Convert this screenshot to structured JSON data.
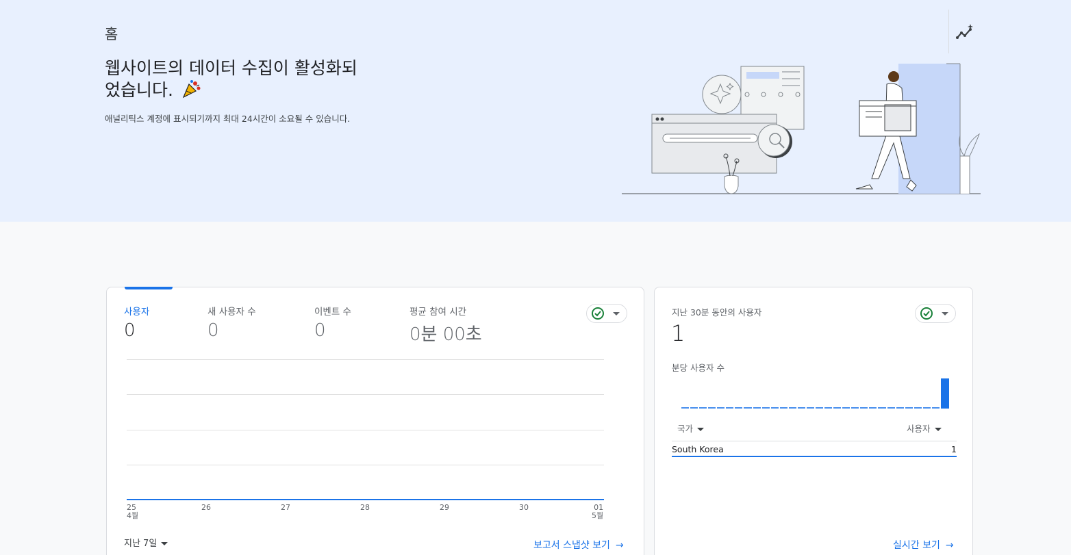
{
  "hero": {
    "title": "홈",
    "headline_line1": "웹사이트의 데이터 수집이 활성화되",
    "headline_line2": "었습니다.",
    "subtext": "애널리틱스 계정에 표시되기까지 최대 24시간이 소요될 수 있습니다."
  },
  "overview_card": {
    "metrics": [
      {
        "label": "사용자",
        "value": "0"
      },
      {
        "label": "새 사용자 수",
        "value": "0"
      },
      {
        "label": "이벤트 수",
        "value": "0"
      },
      {
        "label": "평균 참여 시간",
        "value": "0분 00초"
      }
    ],
    "x_ticks": [
      {
        "day": "25",
        "month": "4월"
      },
      {
        "day": "26",
        "month": ""
      },
      {
        "day": "27",
        "month": ""
      },
      {
        "day": "28",
        "month": ""
      },
      {
        "day": "29",
        "month": ""
      },
      {
        "day": "30",
        "month": ""
      },
      {
        "day": "01",
        "month": "5월"
      }
    ],
    "date_range": "지난 7일",
    "report_link": "보고서 스냅샷 보기"
  },
  "realtime_card": {
    "label": "지난 30분 동안의 사용자",
    "value": "1",
    "per_minute_label": "분당 사용자 수",
    "per_minute_values": [
      0,
      0,
      0,
      0,
      0,
      0,
      0,
      0,
      0,
      0,
      0,
      0,
      0,
      0,
      0,
      0,
      0,
      0,
      0,
      0,
      0,
      0,
      0,
      0,
      0,
      0,
      0,
      0,
      0,
      1
    ],
    "table": {
      "col_country": "국가",
      "col_users": "사용자",
      "rows": [
        {
          "country": "South Korea",
          "users": "1"
        }
      ]
    },
    "realtime_link": "실시간 보기"
  },
  "colors": {
    "accent": "#1a73e8",
    "hero_bg": "#e8f0fe",
    "success": "#188038"
  },
  "icons": {
    "insights": "insights-sparkle-icon",
    "check": "check-circle-icon",
    "arrow": "arrow-right-icon"
  }
}
